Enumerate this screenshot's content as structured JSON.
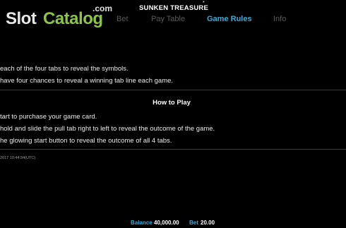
{
  "watermark": {
    "slot": "Slot",
    "catalog": "Catalog",
    "com": ".com"
  },
  "game": {
    "title": "SUNKEN TREASURE",
    "title_mark": "*"
  },
  "tabs": [
    {
      "label": "Bet",
      "active": false
    },
    {
      "label": "Pay Table",
      "active": false
    },
    {
      "label": "Game Rules",
      "active": true
    },
    {
      "label": "Info",
      "active": false
    }
  ],
  "rules": {
    "lines": [
      "each of the four tabs to reveal the symbols.",
      "have four chances to reveal a winning tab line each game."
    ]
  },
  "how_to_play": {
    "heading": "How to Play",
    "lines": [
      "tart to purchase your game card.",
      "hold and slide the pull tab right to left to reveal the outcome of the game.",
      "he glowing start button to reveal the outcome of all 4 tabs."
    ]
  },
  "timestamp": "2017 10:44:34(UTC)",
  "footer": {
    "balance_label": "Balance",
    "balance_value": "40,000.00",
    "bet_label": "Bet",
    "bet_value": "20.00"
  },
  "colors": {
    "background": "#000000",
    "accent": "#3fa9d6",
    "inactive_tab": "#5a5a5a",
    "logo_green": "#8cc63f"
  }
}
